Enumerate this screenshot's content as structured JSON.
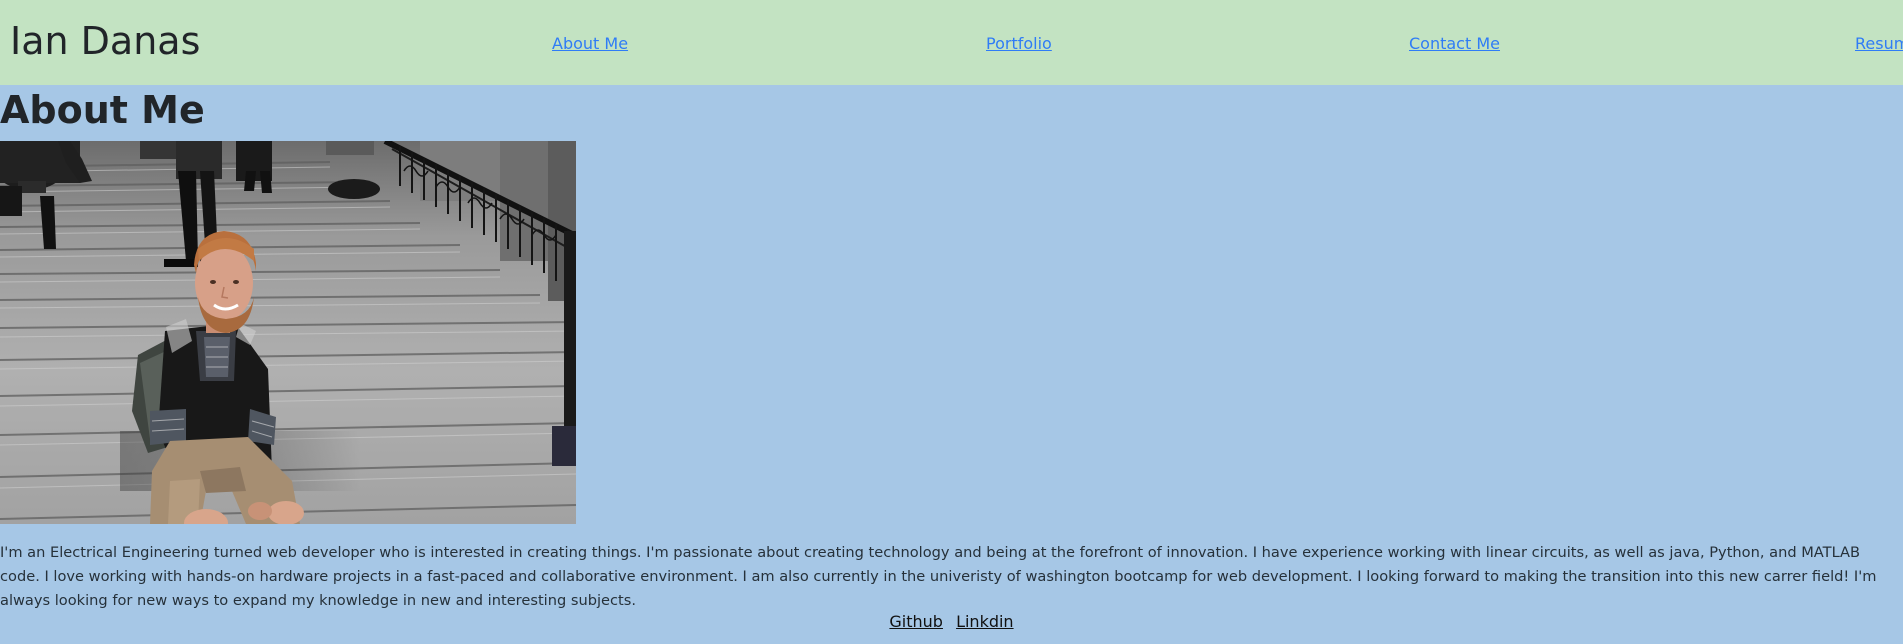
{
  "header": {
    "brand": "Ian Danas",
    "nav": {
      "about": "About Me",
      "portfolio": "Portfolio",
      "contact": "Contact Me",
      "resume": "Resume"
    }
  },
  "main": {
    "title": "About Me",
    "photo_label": "Profile photo",
    "bio": "I'm an Electrical Engineering turned web developer who is interested in creating things. I'm passionate about creating technology and being at the forefront of innovation. I have experience working with linear circuits, as well as java, Python, and MATLAB code. I love working with hands-on hardware projects in a fast-paced and collaborative environment. I am also currently in the univeristy of washington bootcamp for web development. I looking forward to making the transition into this new carrer field! I'm always looking for new ways to expand my knowledge in new and interesting subjects."
  },
  "social": {
    "github": "Github",
    "linkedin": "Linkdin"
  },
  "colors": {
    "page_background": "#a6c7e6",
    "header_background": "#c3e3c2",
    "link": "#2f7cf6",
    "text": "#212529"
  }
}
